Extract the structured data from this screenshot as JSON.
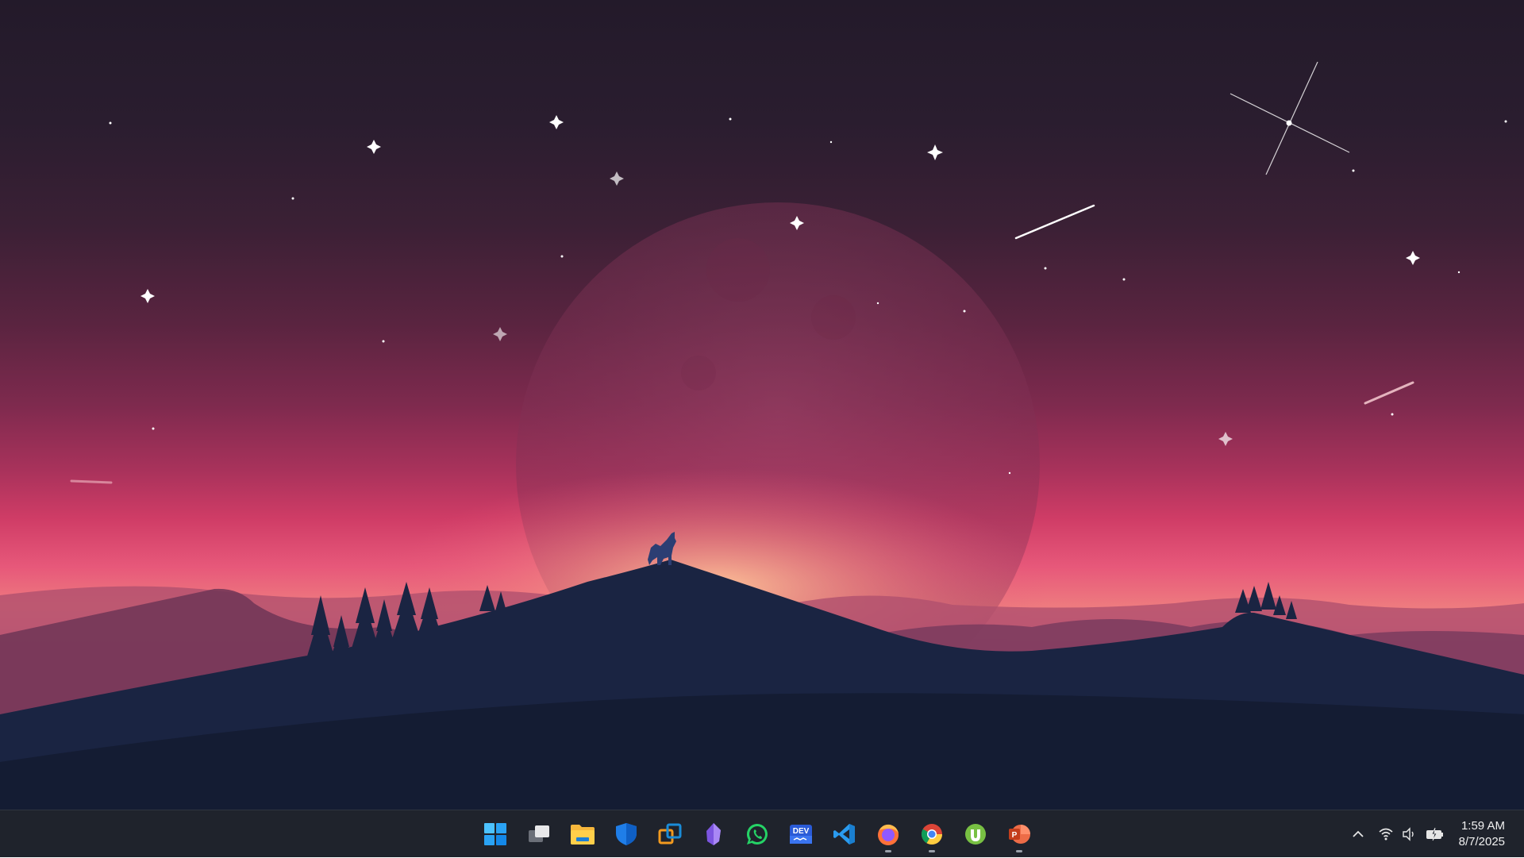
{
  "desktop": {
    "wallpaper": "wolf-moon-mountains",
    "colors": {
      "sky_top": "#231a2a",
      "sky_glow": "#e7587a",
      "moon": "#8a3a5c",
      "hills": "#1a2440",
      "ridge_far": "#a24a6a"
    }
  },
  "taskbar": {
    "background": "#1f232c",
    "apps": [
      {
        "name": "start-button",
        "icon": "windows-logo-icon",
        "running": false
      },
      {
        "name": "task-view-button",
        "icon": "task-view-icon",
        "running": false
      },
      {
        "name": "file-explorer-button",
        "icon": "folder-icon",
        "running": false
      },
      {
        "name": "defender-button",
        "icon": "shield-icon",
        "running": false
      },
      {
        "name": "remote-app-button",
        "icon": "remote-desktop-icon",
        "running": false
      },
      {
        "name": "obsidian-button",
        "icon": "obsidian-icon",
        "running": false
      },
      {
        "name": "whatsapp-button",
        "icon": "whatsapp-icon",
        "running": false
      },
      {
        "name": "devhome-button",
        "icon": "dev-icon",
        "running": false,
        "label": "DEV"
      },
      {
        "name": "vscode-button",
        "icon": "vscode-icon",
        "running": false
      },
      {
        "name": "firefox-button",
        "icon": "firefox-icon",
        "running": true
      },
      {
        "name": "chrome-button",
        "icon": "chrome-icon",
        "running": true
      },
      {
        "name": "utorrent-button",
        "icon": "utorrent-icon",
        "running": false
      },
      {
        "name": "powerpoint-button",
        "icon": "powerpoint-icon",
        "running": true,
        "label": "P"
      }
    ]
  },
  "tray": {
    "chevron": "chevron-up-icon",
    "icons": [
      "wifi-icon",
      "speaker-icon",
      "battery-charging-icon"
    ],
    "time": "1:59 AM",
    "date": "8/7/2025"
  }
}
